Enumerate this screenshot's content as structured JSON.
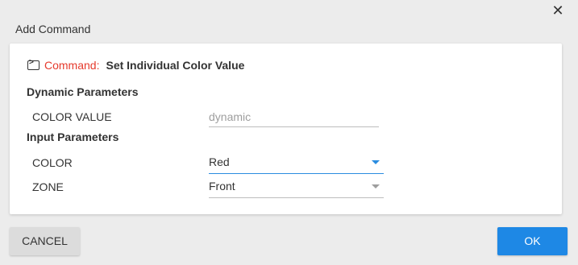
{
  "dialog": {
    "title": "Add Command",
    "close_icon": "close-icon"
  },
  "command": {
    "icon": "terminal-icon",
    "label": "Command",
    "colon": ":",
    "name": "Set Individual Color Value"
  },
  "dynamic_parameters": {
    "heading": "Dynamic Parameters",
    "fields": [
      {
        "label": "COLOR VALUE",
        "placeholder": "dynamic",
        "value": ""
      }
    ]
  },
  "input_parameters": {
    "heading": "Input Parameters",
    "fields": [
      {
        "label": "COLOR",
        "value": "Red",
        "active": true
      },
      {
        "label": "ZONE",
        "value": "Front",
        "active": false
      }
    ]
  },
  "buttons": {
    "cancel": "CANCEL",
    "ok": "OK"
  },
  "colors": {
    "accent": "#1e88e5",
    "command_label": "#e53a2c",
    "background": "#ececec"
  }
}
